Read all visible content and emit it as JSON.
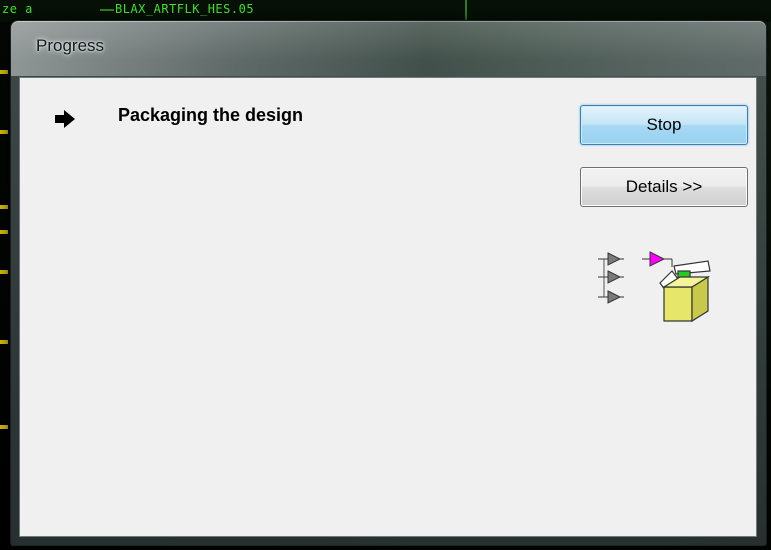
{
  "background": {
    "top_text": "BLAX_ARTFLK_HES.05",
    "left_snip": "ze  a"
  },
  "dialog": {
    "title": "Progress",
    "status_icon": "right-arrow-icon",
    "status_text": "Packaging the design",
    "buttons": {
      "stop_label": "Stop",
      "details_label": "Details >>"
    },
    "illustration_icon": "package-design-icon"
  },
  "colors": {
    "background_trace": "#41e02a",
    "client_area": "#f0f0f0",
    "default_button": "#98d1ef",
    "gate_gray": "#7a7a7a",
    "gate_magenta": "#ff00ff",
    "box_yellow": "#e6e66a"
  }
}
